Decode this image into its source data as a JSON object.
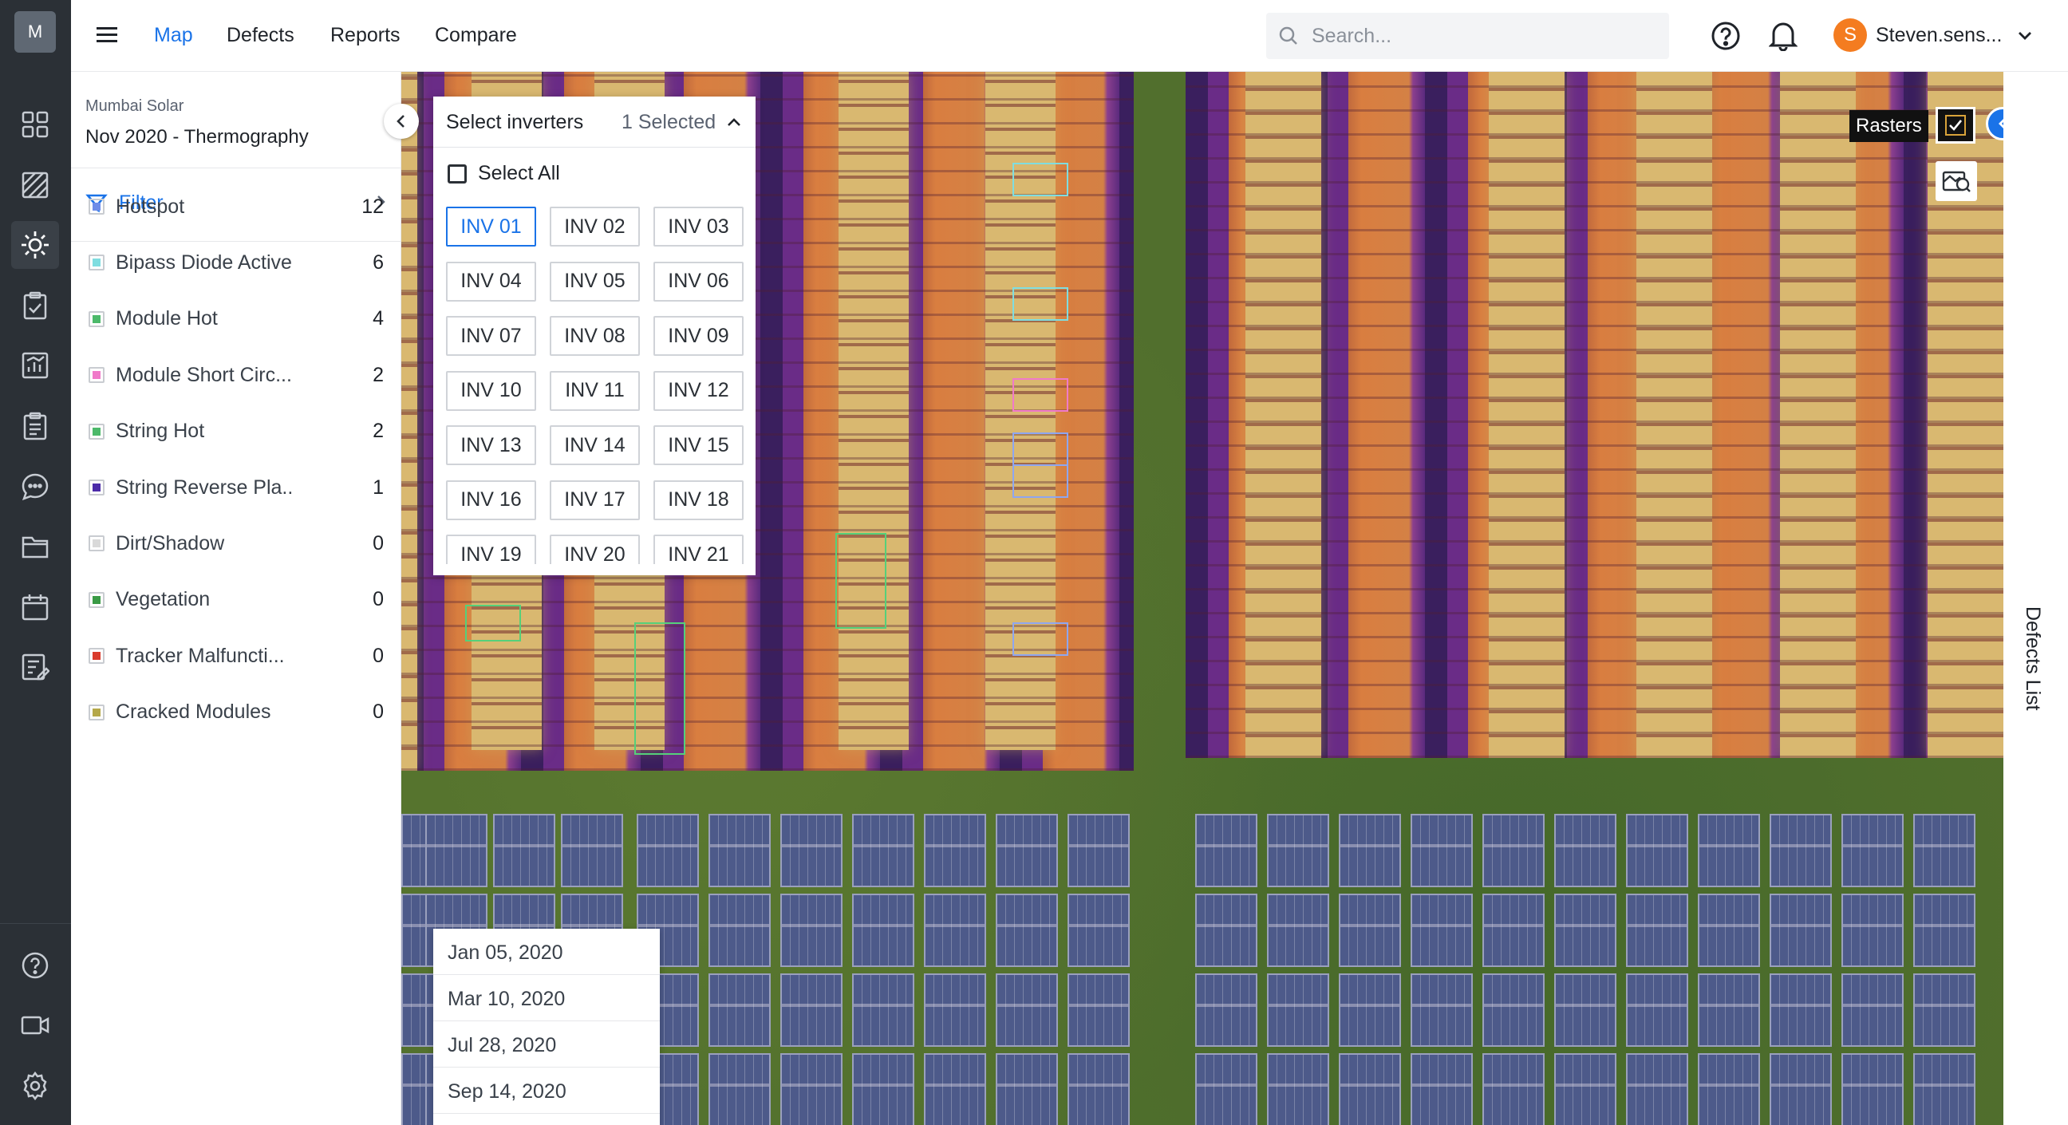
{
  "rail": {
    "logo": "M",
    "icons": [
      "dashboard-icon",
      "map-layer-icon",
      "sun-icon",
      "checklist-icon",
      "report-chart-icon",
      "task-list-icon",
      "chat-icon",
      "folder-icon",
      "calendar-icon",
      "edit-document-icon"
    ],
    "bottom_icons": [
      "help-circle-icon",
      "video-icon",
      "settings-icon"
    ]
  },
  "topbar": {
    "nav": [
      "Map",
      "Defects",
      "Reports",
      "Compare"
    ],
    "active_nav": "Map",
    "search_placeholder": "Search...",
    "avatar_letter": "S",
    "user_name": "Steven.sens..."
  },
  "sidebar": {
    "project": "Mumbai Solar",
    "view": "Nov 2020 - Thermography",
    "filter_label": "Filter",
    "defects": [
      {
        "label": "Hotspot",
        "count": "12",
        "color": "#6f8de8"
      },
      {
        "label": "Bipass Diode Active",
        "count": "6",
        "color": "#7fdde0"
      },
      {
        "label": "Module Hot",
        "count": "4",
        "color": "#4cb96a"
      },
      {
        "label": "Module Short Circ...",
        "count": "2",
        "color": "#f07ac9"
      },
      {
        "label": "String Hot",
        "count": "2",
        "color": "#4cb96a"
      },
      {
        "label": "String Reverse Pla..",
        "count": "1",
        "color": "#4b2aa8"
      },
      {
        "label": "Dirt/Shadow",
        "count": "0",
        "color": "#d9d9d9"
      },
      {
        "label": "Vegetation",
        "count": "0",
        "color": "#3a9a45"
      },
      {
        "label": "Tracker Malfuncti...",
        "count": "0",
        "color": "#d93a2b"
      },
      {
        "label": "Cracked Modules",
        "count": "0",
        "color": "#b5a84a"
      }
    ]
  },
  "inverters": {
    "title": "Select inverters",
    "selected_text": "1 Selected",
    "select_all": "Select All",
    "items": [
      "INV 01",
      "INV 02",
      "INV 03",
      "INV 04",
      "INV 05",
      "INV 06",
      "INV 07",
      "INV 08",
      "INV 09",
      "INV 10",
      "INV 11",
      "INV 12",
      "INV 13",
      "INV 14",
      "INV 15",
      "INV 16",
      "INV 17",
      "INV 18",
      "INV 19",
      "INV 20",
      "INV 21"
    ],
    "selected": "INV 01"
  },
  "map": {
    "rasters_label": "Rasters",
    "defects_list_label": "Defects List"
  },
  "dates": [
    "Jan 05, 2020",
    "Mar 10, 2020",
    "Jul 28, 2020",
    "Sep 14, 2020"
  ]
}
